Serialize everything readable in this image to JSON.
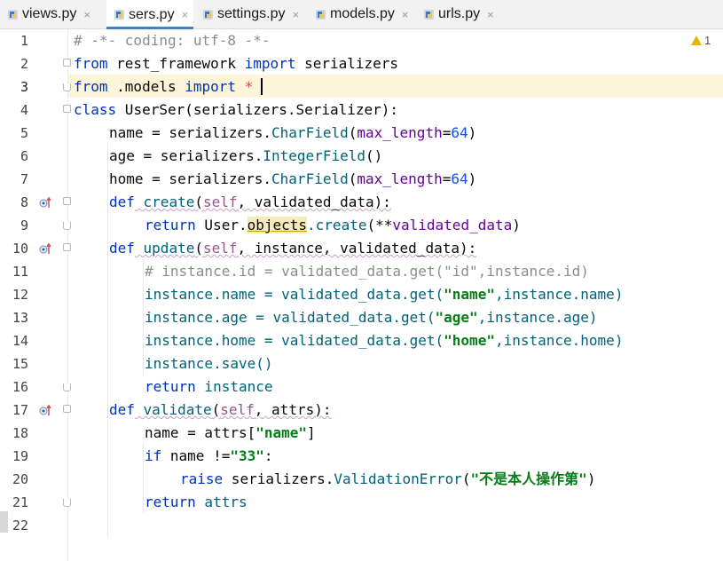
{
  "tabs": [
    {
      "label": "views.py",
      "close": "×"
    },
    {
      "label": "sers.py",
      "close": "×"
    },
    {
      "label": "settings.py",
      "close": "×"
    },
    {
      "label": "models.py",
      "close": "×"
    },
    {
      "label": "urls.py",
      "close": "×"
    }
  ],
  "active_tab": "sers.py",
  "inspection": {
    "count": "1"
  },
  "line_numbers": [
    "1",
    "2",
    "3",
    "4",
    "5",
    "6",
    "7",
    "8",
    "9",
    "10",
    "11",
    "12",
    "13",
    "14",
    "15",
    "16",
    "17",
    "18",
    "19",
    "20",
    "21",
    "22"
  ],
  "current_line": "3",
  "code": {
    "l1": "# -*- coding: utf-8 -*-",
    "l2_kw1": "from",
    "l2_mod": " rest_framework ",
    "l2_kw2": "import",
    "l2_name": " serializers",
    "l3_kw1": "from",
    "l3_mod": " .models ",
    "l3_kw2": "import",
    "l3_star": " *",
    "l4_kw": "class",
    "l4_name": " UserSer",
    "l4_paren": "(serializers.Serializer):",
    "l5_a": "name = serializers.",
    "l5_f": "CharField",
    "l5_b": "(",
    "l5_k": "max_length",
    "l5_e": "=",
    "l5_n": "64",
    "l5_c": ")",
    "l6_a": "age = serializers.",
    "l6_f": "IntegerField",
    "l6_b": "()",
    "l7_a": "home = serializers.",
    "l7_f": "CharField",
    "l7_b": "(",
    "l7_k": "max_length",
    "l7_e": "=",
    "l7_n": "64",
    "l7_c": ")",
    "l8_kw": "def",
    "l8_fn": " create",
    "l8_b": "(",
    "l8_self": "self",
    "l8_c": ", validated_data):",
    "l9_kw": "return",
    "l9_a": " User.",
    "l9_obj": "objects",
    "l9_m": ".create",
    "l9_b": "(**",
    "l9_v": "validated_data",
    "l9_c": ")",
    "l10_kw": "def",
    "l10_fn": " update",
    "l10_b": "(",
    "l10_self": "self",
    "l10_c": ", instance, validated_data):",
    "l11": "# instance.id = validated_data.get(\"id\",instance.id)",
    "l12_a": "instance.name = validated_data.get(",
    "l12_s": "\"name\"",
    "l12_b": ",instance.name)",
    "l13_a": "instance.age = validated_data.get(",
    "l13_s": "\"age\"",
    "l13_b": ",instance.age)",
    "l14_a": "instance.home = validated_data.get(",
    "l14_s": "\"home\"",
    "l14_b": ",instance.home)",
    "l15": "instance.save()",
    "l16_kw": "return",
    "l16_a": " instance",
    "l17_kw": "def",
    "l17_fn": " validate",
    "l17_b": "(",
    "l17_self": "self",
    "l17_c": ", attrs):",
    "l18_a": "name = attrs[",
    "l18_s": "\"name\"",
    "l18_b": "]",
    "l19_kw": "if",
    "l19_a": " name !=",
    "l19_s": "\"33\"",
    "l19_b": ":",
    "l20_kw": "raise",
    "l20_a": " serializers.",
    "l20_f": "ValidationError",
    "l20_b": "(",
    "l20_s": "\"不是本人操作第\"",
    "l20_c": ")",
    "l21_kw": "return",
    "l21_a": " attrs"
  },
  "colors": {
    "keyword": "#0033b3",
    "comment": "#8c8c8c",
    "call": "#00627a",
    "string": "#067d17",
    "kwarg": "#660099",
    "number": "#1750eb",
    "self": "#94558d",
    "current_line_bg": "#fcf5d9",
    "tab_underline": "#4083c9"
  },
  "icons": [
    "python-file-icon",
    "close-icon",
    "warning-icon",
    "override-method-icon",
    "fold-icon"
  ]
}
